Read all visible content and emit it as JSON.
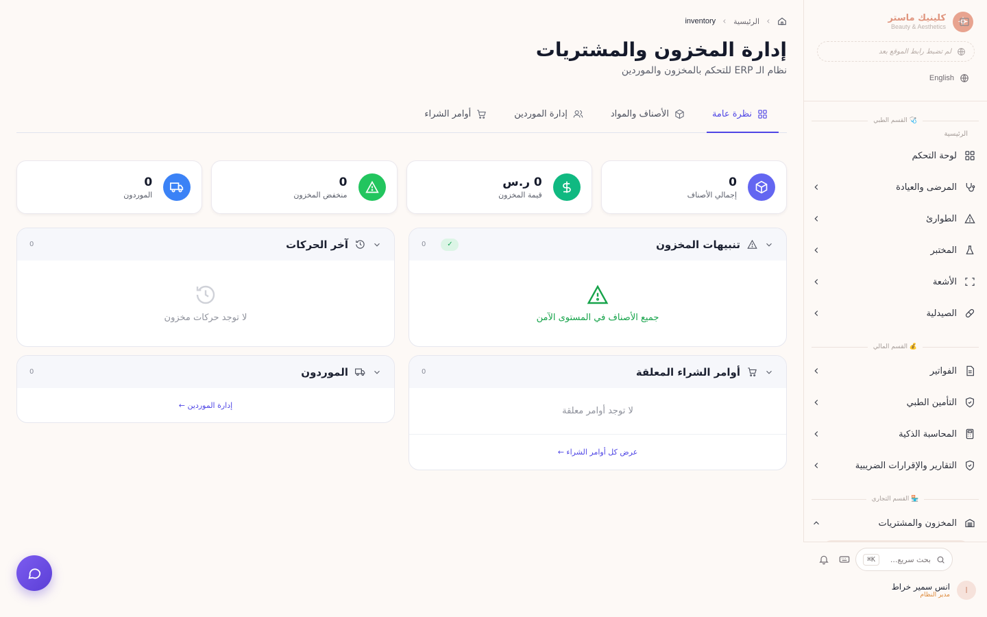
{
  "brand": {
    "name": "كلينيك ماستر",
    "tagline": "Beauty & Aesthetics"
  },
  "site_link": "لم تضبط رابط الموقع بعد",
  "language": "English",
  "sidebar": {
    "medical_section": "🩺 القسم الطبي",
    "home_label": "الرئيسية",
    "medical_items": [
      {
        "label": "لوحة التحكم"
      },
      {
        "label": "المرضى والعيادة"
      },
      {
        "label": "الطوارئ"
      },
      {
        "label": "المختبر"
      },
      {
        "label": "الأشعة"
      },
      {
        "label": "الصيدلية"
      }
    ],
    "financial_section": "💰 القسم المالي",
    "financial_items": [
      {
        "label": "الفواتير"
      },
      {
        "label": "التأمين الطبي"
      },
      {
        "label": "المحاسبة الذكية"
      },
      {
        "label": "التقارير والإقرارات الضريبية"
      }
    ],
    "commercial_section": "🏪 القسم التجاري",
    "commercial_items": [
      {
        "label": "المخزون والمشتريات"
      }
    ],
    "search_placeholder": "بحث سريع...",
    "search_shortcut": "⌘K",
    "user_name": "انس سمير خراط",
    "user_role": "مدير النظام",
    "user_initial": "ا"
  },
  "breadcrumb": {
    "home": "الرئيسية",
    "current": "inventory"
  },
  "page": {
    "title": "إدارة المخزون والمشتريات",
    "subtitle": "نظام الـ ERP للتحكم بالمخزون والموردين"
  },
  "tabs": [
    {
      "label": "نظرة عامة",
      "active": true
    },
    {
      "label": "الأصناف والمواد",
      "active": false
    },
    {
      "label": "إدارة الموردين",
      "active": false
    },
    {
      "label": "أوامر الشراء",
      "active": false
    }
  ],
  "stats": [
    {
      "value": "0",
      "label": "إجمالي الأصناف",
      "color": "#6366f1"
    },
    {
      "value": "0 ر.س",
      "label": "قيمة المخزون",
      "color": "#10b981"
    },
    {
      "value": "0",
      "label": "منخفض المخزون",
      "color": "#22c55e"
    },
    {
      "value": "0",
      "label": "الموردون",
      "color": "#3b82f6"
    }
  ],
  "panels": {
    "alerts": {
      "title": "تنبيهات المخزون",
      "count": "0",
      "badge": "✓",
      "message": "جميع الأصناف في المستوى الآمن"
    },
    "movements": {
      "title": "آخر الحركات",
      "count": "0",
      "message": "لا توجد حركات مخزون"
    },
    "orders": {
      "title": "أوامر الشراء المعلقة",
      "count": "0",
      "message": "لا توجد أوامر معلقة",
      "link": "عرض كل أوامر الشراء ←"
    },
    "suppliers": {
      "title": "الموردون",
      "count": "0",
      "link": "إدارة الموردين ←"
    }
  }
}
